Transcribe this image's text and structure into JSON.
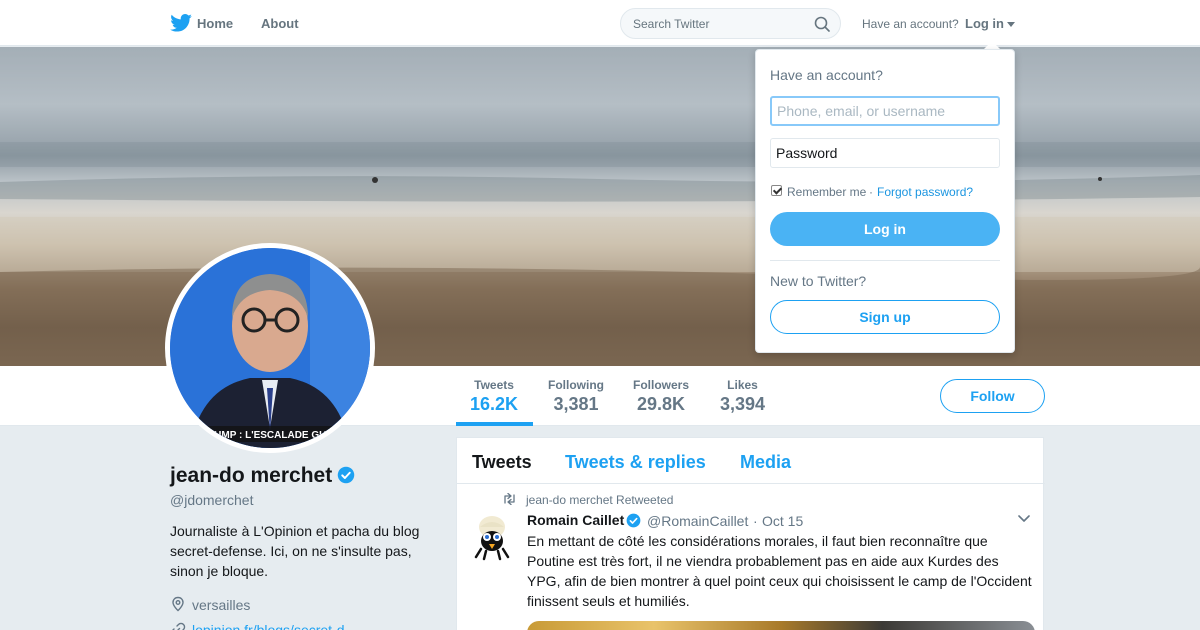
{
  "nav": {
    "home_label": "Home",
    "about_label": "About",
    "search_placeholder": "Search Twitter",
    "have_account": "Have an account?",
    "login_label": "Log in"
  },
  "profile": {
    "name": "jean-do merchet",
    "handle": "@jdomerchet",
    "bio": "Journaliste à L'Opinion et pacha du blog secret-defense. Ici, on ne s'insulte pas, sinon je bloque.",
    "location": "versailles",
    "link": "lopinion.fr/blogs/secret-d",
    "avatar_caption": "RUMP : L'ESCALADE GUE"
  },
  "stats": [
    {
      "label": "Tweets",
      "value": "16.2K"
    },
    {
      "label": "Following",
      "value": "3,381"
    },
    {
      "label": "Followers",
      "value": "29.8K"
    },
    {
      "label": "Likes",
      "value": "3,394"
    }
  ],
  "follow_label": "Follow",
  "timeline": {
    "tabs": [
      "Tweets",
      "Tweets & replies",
      "Media"
    ],
    "retweet_context": "jean-do merchet Retweeted",
    "tweet": {
      "name": "Romain Caillet",
      "handle": "@RomainCaillet",
      "separator": "·",
      "date": "Oct 15",
      "text": "En mettant de côté les considérations morales, il faut bien reconnaître que Poutine est très fort, il ne viendra probablement pas en aide aux Kurdes des YPG, afin de bien montrer à quel point ceux qui choisissent le camp de l'Occident finissent seuls et humiliés."
    }
  },
  "login_dropdown": {
    "title": "Have an account?",
    "username_placeholder": "Phone, email, or username",
    "password_placeholder": "Password",
    "remember_label": "Remember me",
    "separator": "·",
    "forgot_label": "Forgot password?",
    "login_button": "Log in",
    "new_label": "New to Twitter?",
    "signup_button": "Sign up"
  },
  "colors": {
    "accent": "#1da1f2",
    "login_button_bg": "#4ab3f4",
    "page_bg": "#e6ecf0"
  },
  "icons": [
    "twitter-bird-icon",
    "search-icon",
    "caret-down-icon",
    "verified-icon",
    "location-pin-icon",
    "link-icon",
    "retweet-icon",
    "chevron-down-icon"
  ]
}
